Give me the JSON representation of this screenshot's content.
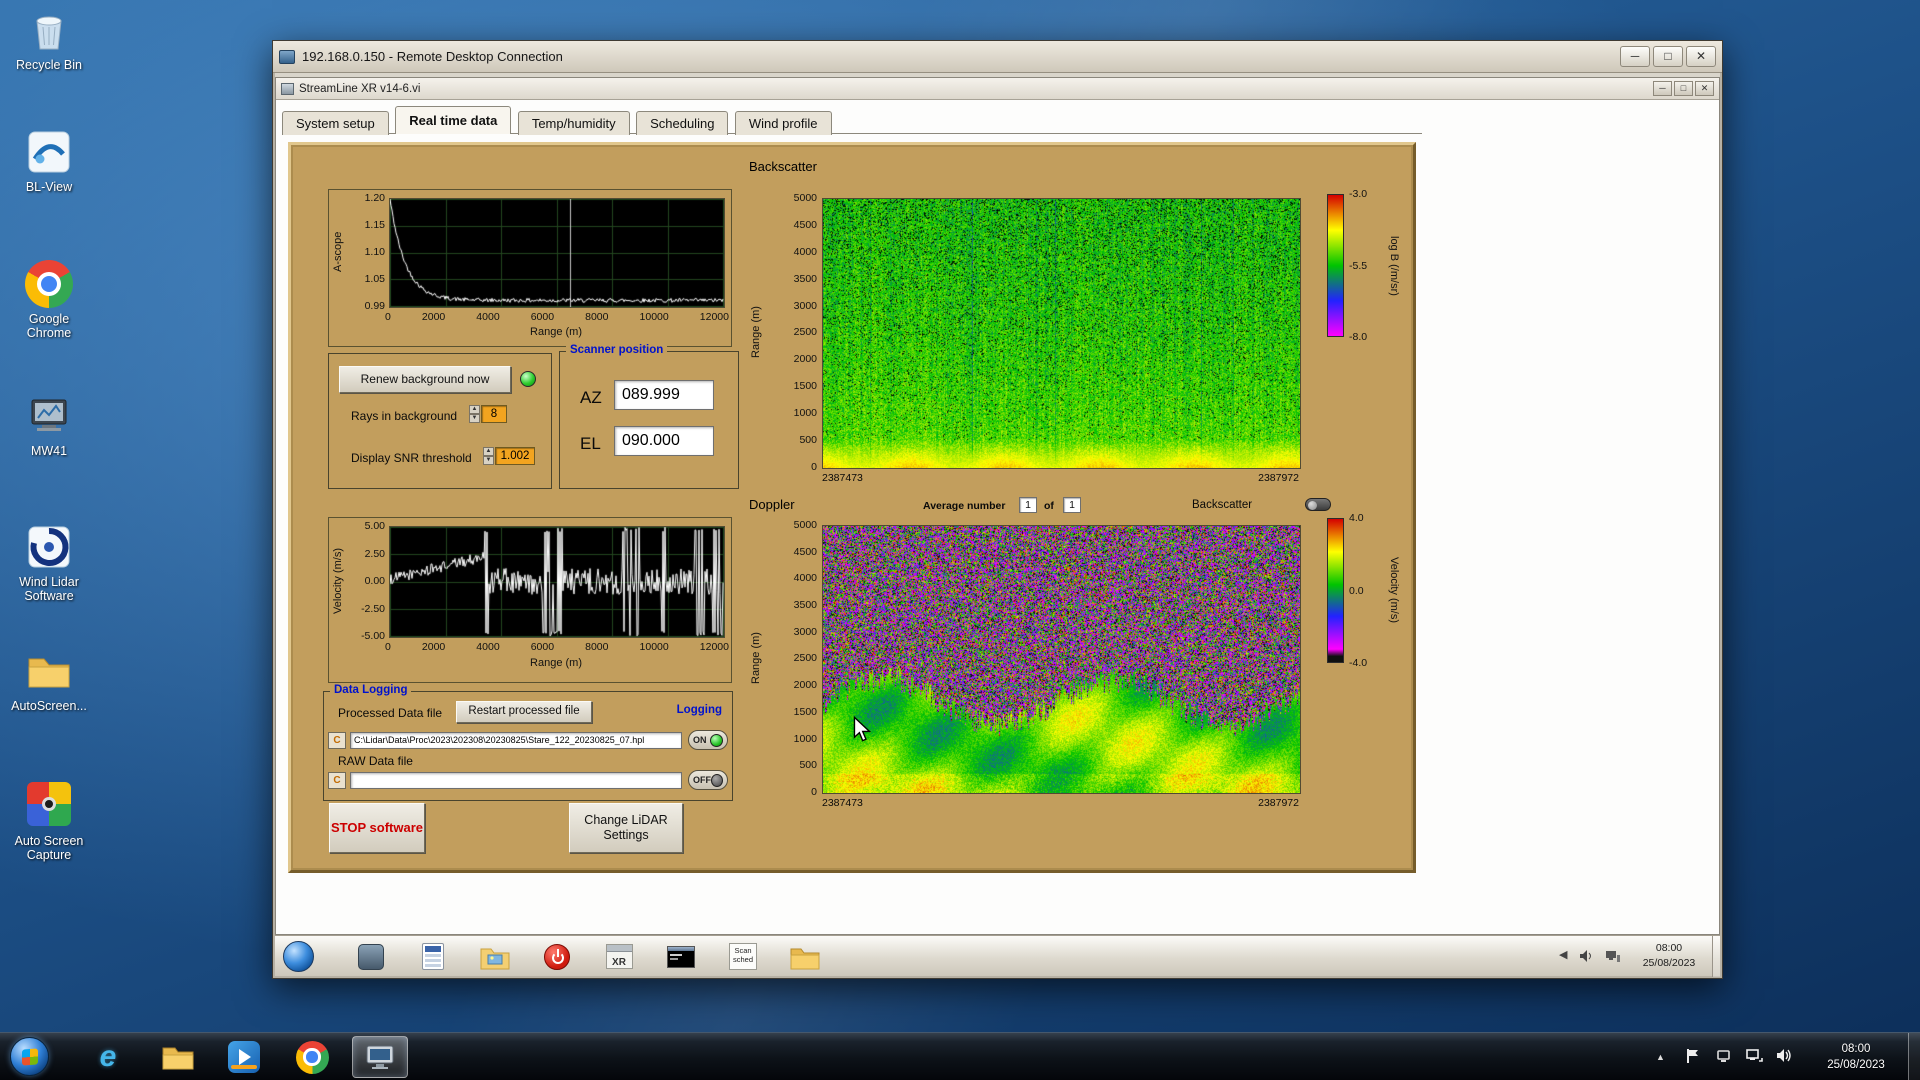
{
  "desktop": {
    "icons": [
      {
        "label": "Recycle Bin"
      },
      {
        "label": "BL-View"
      },
      {
        "label": "Google Chrome"
      },
      {
        "label": "MW41"
      },
      {
        "label": "Wind Lidar Software"
      },
      {
        "label": "AutoScreen..."
      },
      {
        "label": "Auto Screen Capture"
      }
    ]
  },
  "rdp": {
    "title": "192.168.0.150 - Remote Desktop Connection"
  },
  "app": {
    "title": "StreamLine XR v14-6.vi",
    "tabs": [
      "System setup",
      "Real time data",
      "Temp/humidity",
      "Scheduling",
      "Wind profile"
    ],
    "active_tab": "Real time data"
  },
  "controls": {
    "renew_button": "Renew background now",
    "rays_label": "Rays in background",
    "rays_value": "8",
    "snr_label": "Display SNR threshold",
    "snr_value": "1.002",
    "scanner_group": "Scanner position",
    "az_label": "AZ",
    "az_value": "089.999",
    "el_label": "EL",
    "el_value": "090.000"
  },
  "data_logging": {
    "group_label": "Data Logging",
    "processed_label": "Processed Data file",
    "restart_button": "Restart processed file",
    "logging_label": "Logging",
    "processed_path": "C:\\Lidar\\Data\\Proc\\2023\\202308\\20230825\\Stare_122_20230825_07.hpl",
    "processed_to ggle_ignore": "",
    "processed_toggle": "ON",
    "raw_label": "RAW Data file",
    "raw_path": "",
    "raw_toggle": "OFF"
  },
  "action_buttons": {
    "stop": "STOP software",
    "change_settings": "Change LiDAR Settings"
  },
  "doppler_header": {
    "average_label": "Average number",
    "average_value": "1",
    "of_label": "of",
    "of_value": "1",
    "backscatter_toggle_label": "Backscatter"
  },
  "remote_taskbar": {
    "clock_time": "08:00",
    "clock_date": "25/08/2023",
    "xr_label": "XR",
    "scan_label": "Scan sched"
  },
  "taskbar": {
    "clock_time": "08:00",
    "clock_date": "25/08/2023"
  },
  "colors": {
    "panel_tan": "#c29e5d",
    "label_blue": "#0012cc",
    "field_orange": "#f2a41f",
    "led_green": "#2ecc2e",
    "stop_red": "#cc0000"
  },
  "chart_data": [
    {
      "type": "line",
      "title": "A-scope",
      "xlabel": "Range (m)",
      "ylabel": "A-scope",
      "xlim": [
        0,
        12000
      ],
      "ylim": [
        0.99,
        1.2
      ],
      "xtick_labels": [
        "0",
        "2000",
        "4000",
        "6000",
        "8000",
        "10000",
        "12000"
      ],
      "ytick_labels": [
        "1.20",
        "1.15",
        "1.10",
        "1.05",
        "0.99"
      ],
      "series": [
        {
          "name": "A-scope",
          "peak": 1.2,
          "floor": 1.001,
          "decay_m": 550,
          "noise": 0.004
        }
      ],
      "cursor_x": 6500,
      "grid": true,
      "description": "Background A-scope trace decaying from 1.20 at 0 m to a ~1.00 noise floor beyond 2000 m, vertical cursor near 6500 m"
    },
    {
      "type": "line",
      "title": "Velocity",
      "xlabel": "Range (m)",
      "ylabel": "Velocity (m/s)",
      "xlim": [
        0,
        12000
      ],
      "ylim": [
        -5,
        5
      ],
      "xtick_labels": [
        "0",
        "2000",
        "4000",
        "6000",
        "8000",
        "10000",
        "12000"
      ],
      "ytick_labels": [
        "5.00",
        "2.50",
        "0.00",
        "-2.50",
        "-5.00"
      ],
      "series": [
        {
          "name": "Velocity",
          "coherent_max_m": 3400,
          "start_v": 0.2,
          "end_v": 2.3,
          "noise": 0.5,
          "spike_fraction": 0.85
        }
      ],
      "grid": true,
      "description": "Radial velocity vs range: coherent 0 to 2.5 m/s out to ~3400 m, full-scale noise bars beyond"
    },
    {
      "type": "heatmap",
      "title": "Backscatter",
      "ylabel": "Range (m)",
      "ylim": [
        0,
        5000
      ],
      "ytick_labels": [
        "5000",
        "4500",
        "4000",
        "3500",
        "3000",
        "2500",
        "2000",
        "1500",
        "1000",
        "500",
        "0"
      ],
      "x_start_label": "2387473",
      "x_end_label": "2387972",
      "value_lim": [
        -8,
        -3
      ],
      "base_value": -5.5,
      "noise_amp": 0.5,
      "surface_value": -4.05,
      "surface_top_m": 520,
      "dark_speckle": 0.14,
      "colorbar": {
        "label": "log B (/m/sr)",
        "tick_labels": [
          "-3.0",
          "-5.5",
          "-8.0"
        ],
        "black_tail": false
      },
      "colormap": [
        "#ff00ff",
        "#2222ff",
        "#00c400",
        "#ffff00",
        "#d40000"
      ],
      "description": "Attenuated backscatter time-height plot: speckled green (~10^-5.5) aloft with dark dropouts, bright yellow-orange aerosol layer below ~500 m"
    },
    {
      "type": "heatmap",
      "title": "Doppler",
      "ylabel": "Range (m)",
      "ylim": [
        0,
        5000
      ],
      "ytick_labels": [
        "5000",
        "4500",
        "4000",
        "3500",
        "3000",
        "2500",
        "2000",
        "1500",
        "1000",
        "500",
        "0"
      ],
      "x_start_label": "2387473",
      "x_end_label": "2387972",
      "value_lim": [
        -4,
        4
      ],
      "signal_top_m": 1700,
      "flow_value": 0.7,
      "noise_extreme_fraction": 0.5,
      "black_fraction": 0.12,
      "colorbar": {
        "label": "Velocity (m/s)",
        "tick_labels": [
          "4.0",
          "0.0",
          "-4.0"
        ],
        "black_tail": true
      },
      "colormap": [
        "#ff00ff",
        "#2222ff",
        "#00c400",
        "#ffff00",
        "#d40000"
      ],
      "description": "Doppler velocity time-height plot: coherent green-yellow 0-2 m/s flow below ~1700 m, magenta/green random noise aloft"
    }
  ]
}
